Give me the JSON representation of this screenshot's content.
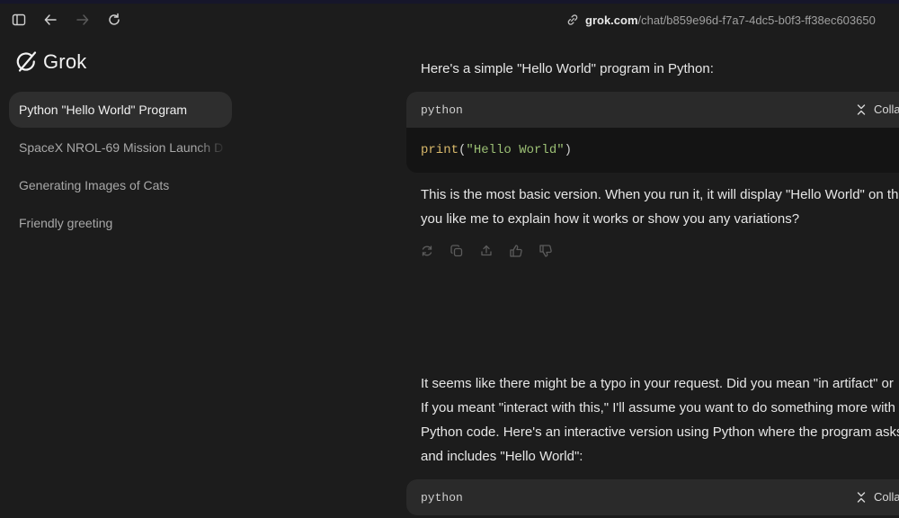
{
  "browser": {
    "url_host": "grok.com",
    "url_path": "/chat/b859e96d-f7a7-4dc5-b0f3-ff38ec603650"
  },
  "sidebar": {
    "logo_text": "Grok",
    "chats": [
      {
        "label": "Python \"Hello World\" Program",
        "active": true
      },
      {
        "label": "SpaceX NROL-69 Mission Launch D",
        "active": false
      },
      {
        "label": "Generating Images of Cats",
        "active": false
      },
      {
        "label": "Friendly greeting",
        "active": false
      }
    ]
  },
  "conversation": {
    "intro": "Here's a simple \"Hello World\" program in Python:",
    "code_block_1": {
      "language": "python",
      "collapse_label": "Collapse",
      "code": {
        "fn": "print",
        "open": "(",
        "str": "\"Hello World\"",
        "close": ")"
      }
    },
    "explanation_line1": "This is the most basic version. When you run it, it will display \"Hello World\" on the screen. Would",
    "explanation_line2": "you like me to explain how it works or show you any variations?",
    "reply_line1": "It seems like there might be a typo in your request. Did you mean \"in artifact\" or",
    "reply_line2": "If you meant \"interact with this,\" I'll assume you want to do something more with the",
    "reply_line3": "Python code. Here's an interactive version using Python where the program asks for input",
    "reply_line4": "and includes \"Hello World\":",
    "code_block_2": {
      "language": "python",
      "collapse_label": "Collapse"
    }
  },
  "icons": [
    "sidebar-toggle-icon",
    "back-arrow-icon",
    "forward-arrow-icon",
    "reload-icon",
    "link-icon",
    "grok-logo-icon",
    "regenerate-icon",
    "copy-icon",
    "share-icon",
    "thumbs-up-icon",
    "thumbs-down-icon",
    "collapse-icon"
  ]
}
